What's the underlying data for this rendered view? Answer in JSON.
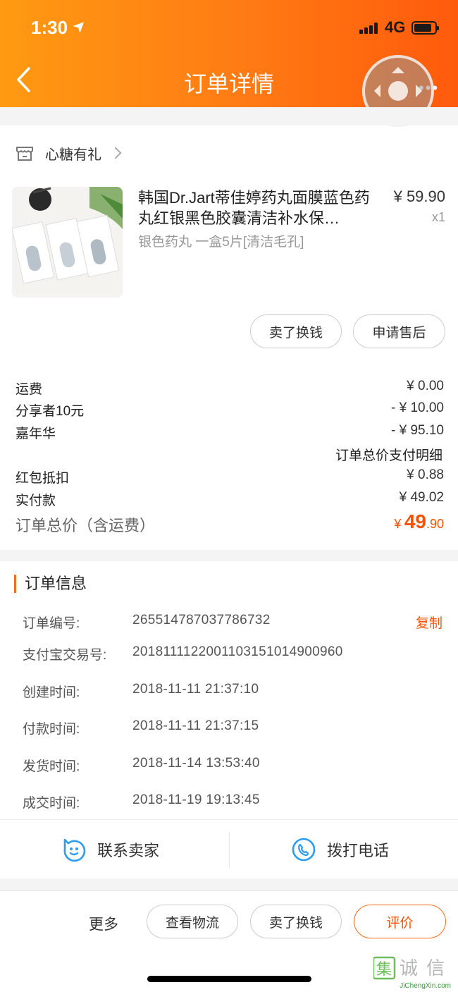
{
  "status_bar": {
    "time": "1:30",
    "location_arrow": "➤",
    "network": "4G"
  },
  "header": {
    "title": "订单详情",
    "more": "•••"
  },
  "shop": {
    "name": "心糖有礼"
  },
  "product": {
    "title": "韩国Dr.Jart蒂佳婷药丸面膜蓝色药丸红银黑色胶囊清洁补水保…",
    "spec": "银色药丸 一盒5片[清洁毛孔]",
    "price": "¥ 59.90",
    "qty": "x1",
    "actions": [
      "卖了换钱",
      "申请售后"
    ]
  },
  "fees": [
    {
      "label": "运费",
      "value": "¥ 0.00"
    },
    {
      "label": "分享者10元",
      "value": "- ¥ 10.00"
    },
    {
      "label": "嘉年华",
      "value": "- ¥ 95.10"
    },
    {
      "label": "红包抵扣",
      "value": "¥ 0.88"
    },
    {
      "label": "实付款",
      "value": "¥ 49.02"
    }
  ],
  "pay_detail_link": "订单总价支付明细",
  "total": {
    "label": "订单总价（含运费）",
    "currency": "¥",
    "integer": "49",
    "decimal": ".90"
  },
  "order_info": {
    "heading": "订单信息",
    "copy_label": "复制",
    "rows": [
      {
        "label": "订单编号:",
        "value": "265514787037786732"
      },
      {
        "label": "支付宝交易号:",
        "value": "2018111122001103151014900960"
      },
      {
        "label": "创建时间:",
        "value": "2018-11-11 21:37:10"
      },
      {
        "label": "付款时间:",
        "value": "2018-11-11 21:37:15"
      },
      {
        "label": "发货时间:",
        "value": "2018-11-14 13:53:40"
      },
      {
        "label": "成交时间:",
        "value": "2018-11-19 19:13:45"
      }
    ]
  },
  "contact": {
    "seller": "联系卖家",
    "phone": "拨打电话"
  },
  "bottom": {
    "more": "更多",
    "buttons": [
      "查看物流",
      "卖了换钱",
      "评价"
    ]
  },
  "watermark": {
    "chars": "集诚信",
    "site": "JiChengXin.com"
  },
  "colors": {
    "accent": "#ff5000",
    "header_start": "#ff9a12",
    "header_end": "#ff5a0c",
    "link_blue": "#2b9df0"
  }
}
